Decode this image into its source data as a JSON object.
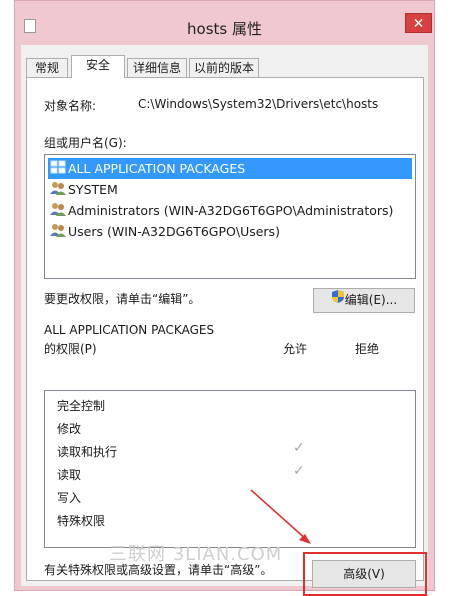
{
  "window": {
    "title": "hosts 属性",
    "close_glyph": "✕"
  },
  "tabs": [
    {
      "label": "常规"
    },
    {
      "label": "安全"
    },
    {
      "label": "详细信息"
    },
    {
      "label": "以前的版本"
    }
  ],
  "security": {
    "object_name_label": "对象名称:",
    "object_name_value": "C:\\Windows\\System32\\Drivers\\etc\\hosts",
    "groups_label": "组或用户名(G):",
    "groups": [
      {
        "name": "ALL APPLICATION PACKAGES",
        "icon": "app-packages-icon",
        "selected": true
      },
      {
        "name": "SYSTEM",
        "icon": "users-icon"
      },
      {
        "name": "Administrators (WIN-A32DG6T6GPO\\Administrators)",
        "icon": "users-icon"
      },
      {
        "name": "Users (WIN-A32DG6T6GPO\\Users)",
        "icon": "users-icon"
      }
    ],
    "change_hint": "要更改权限，请单击“编辑”。",
    "edit_button": "编辑(E)...",
    "perm_header_line1": "ALL APPLICATION PACKAGES",
    "perm_header_line2": "的权限(P)",
    "allow_col": "允许",
    "deny_col": "拒绝",
    "permissions": [
      {
        "name": "完全控制",
        "allow": false
      },
      {
        "name": "修改",
        "allow": false
      },
      {
        "name": "读取和执行",
        "allow": true
      },
      {
        "name": "读取",
        "allow": true
      },
      {
        "name": "写入",
        "allow": false
      },
      {
        "name": "特殊权限",
        "allow": false
      }
    ],
    "check_glyph": "✓",
    "advanced_hint": "有关特殊权限或高级设置，请单击“高级”。",
    "advanced_button": "高级(V)"
  },
  "watermark": "三联网 3LIAN.COM",
  "annotation": {
    "highlight_color": "#e03030"
  }
}
